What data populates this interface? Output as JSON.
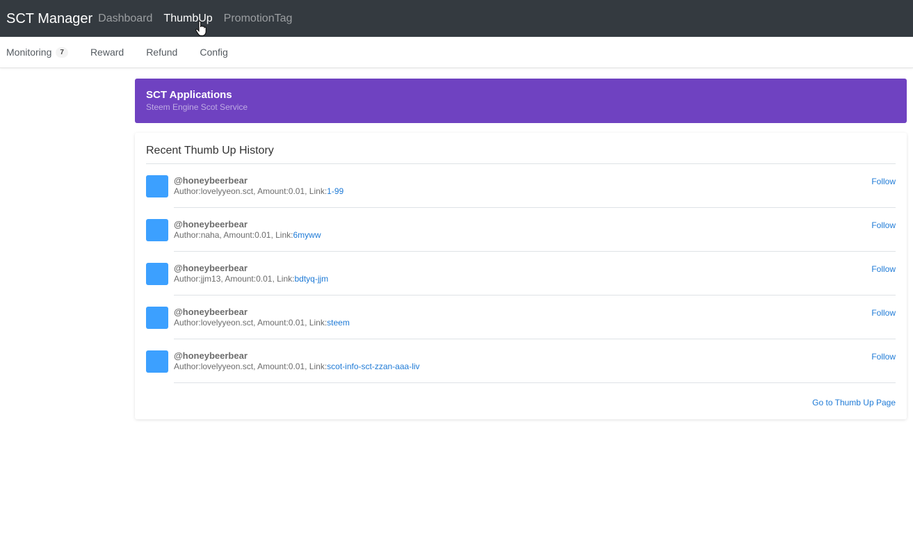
{
  "navbar": {
    "brand": "SCT Manager",
    "links": [
      {
        "label": "Dashboard"
      },
      {
        "label": "ThumbUp"
      },
      {
        "label": "PromotionTag"
      }
    ]
  },
  "subnav": {
    "items": [
      {
        "label": "Monitoring",
        "badge": "7"
      },
      {
        "label": "Reward"
      },
      {
        "label": "Refund"
      },
      {
        "label": "Config"
      }
    ]
  },
  "banner": {
    "title": "SCT Applications",
    "subtitle": "Steem Engine Scot Service"
  },
  "history": {
    "title": "Recent Thumb Up History",
    "author_prefix": "Author:",
    "amount_prefix": ", Amount:",
    "link_prefix": ", Link:",
    "follow_label": "Follow",
    "footer_link": "Go to Thumb Up Page",
    "items": [
      {
        "user": "@honeybeerbear",
        "author": "lovelyyeon.sct",
        "amount": "0.01",
        "link": "1-99"
      },
      {
        "user": "@honeybeerbear",
        "author": "naha",
        "amount": "0.01",
        "link": "6myww"
      },
      {
        "user": "@honeybeerbear",
        "author": "jjm13",
        "amount": "0.01",
        "link": "bdtyq-jjm"
      },
      {
        "user": "@honeybeerbear",
        "author": "lovelyyeon.sct",
        "amount": "0.01",
        "link": "steem"
      },
      {
        "user": "@honeybeerbear",
        "author": "lovelyyeon.sct",
        "amount": "0.01",
        "link": "scot-info-sct-zzan-aaa-liv"
      }
    ]
  },
  "colors": {
    "navbar_bg": "#343a40",
    "banner_bg": "#6f42c1",
    "avatar": "#3ca0ff",
    "link": "#1e7ad6"
  },
  "icons": {
    "cursor": "hand-pointer-icon"
  }
}
